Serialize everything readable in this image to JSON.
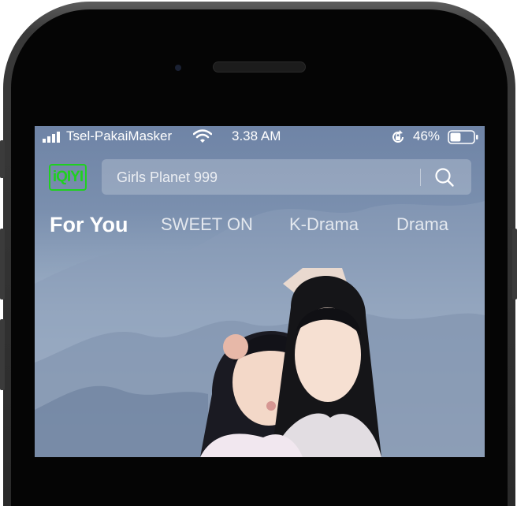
{
  "status_bar": {
    "carrier": "Tsel-PakaiMasker",
    "time": "3.38 AM",
    "battery_percent": "46%",
    "battery_level": 0.46,
    "icons": [
      "signal-icon",
      "wifi-icon",
      "orientation-lock-icon",
      "battery-icon"
    ]
  },
  "header": {
    "logo_text": "iQIYI",
    "search_placeholder": "Girls Planet 999",
    "search_icon": "search-icon"
  },
  "tabs": [
    {
      "label": "For You",
      "active": true
    },
    {
      "label": "SWEET ON",
      "active": false
    },
    {
      "label": "K-Drama",
      "active": false
    },
    {
      "label": "Drama",
      "active": false
    }
  ],
  "colors": {
    "brand_green": "#1fd11f",
    "sky_top": "#6f84a6",
    "sky_bottom": "#b8c6d4"
  }
}
